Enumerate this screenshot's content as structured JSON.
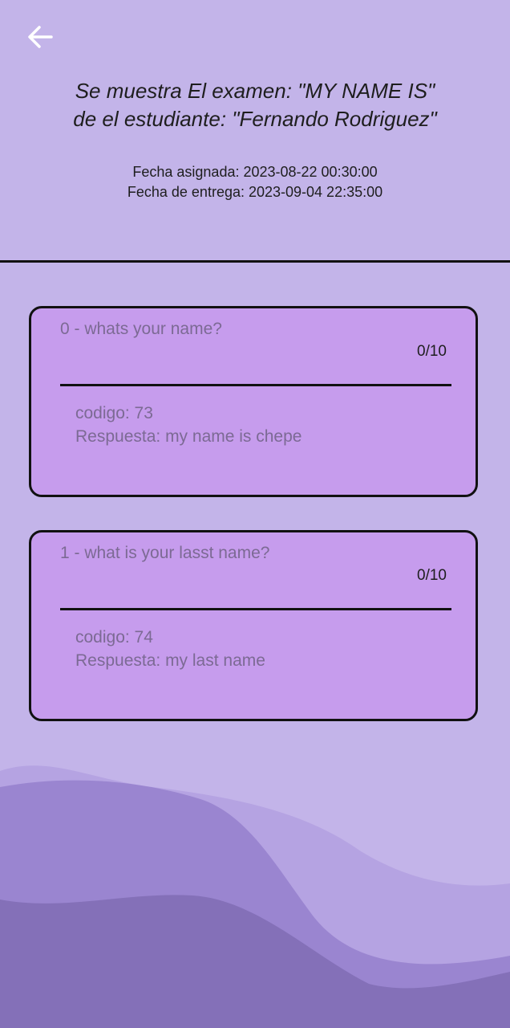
{
  "header": {
    "title_line1": "Se muestra El examen: \"MY NAME IS\"",
    "title_line2": "de el estudiante: \"Fernando Rodriguez\"",
    "fecha_asignada": "Fecha asignada: 2023-08-22 00:30:00",
    "fecha_entrega": "Fecha de entrega: 2023-09-04 22:35:00",
    "back_icon": "arrow-left-icon"
  },
  "questions": [
    {
      "question": "0 - whats your name?",
      "score": "0/10",
      "code": "codigo: 73",
      "answer": "Respuesta: my name is chepe"
    },
    {
      "question": "1 - what is your lasst name?",
      "score": "0/10",
      "code": "codigo: 74",
      "answer": "Respuesta: my last name"
    }
  ],
  "colors": {
    "background": "#c3b4e9",
    "card": "#c69ced",
    "muted_text": "#7c6a94",
    "wave_light": "#b5a3e2",
    "wave_mid": "#9a85d0",
    "wave_dark": "#8470b8"
  }
}
